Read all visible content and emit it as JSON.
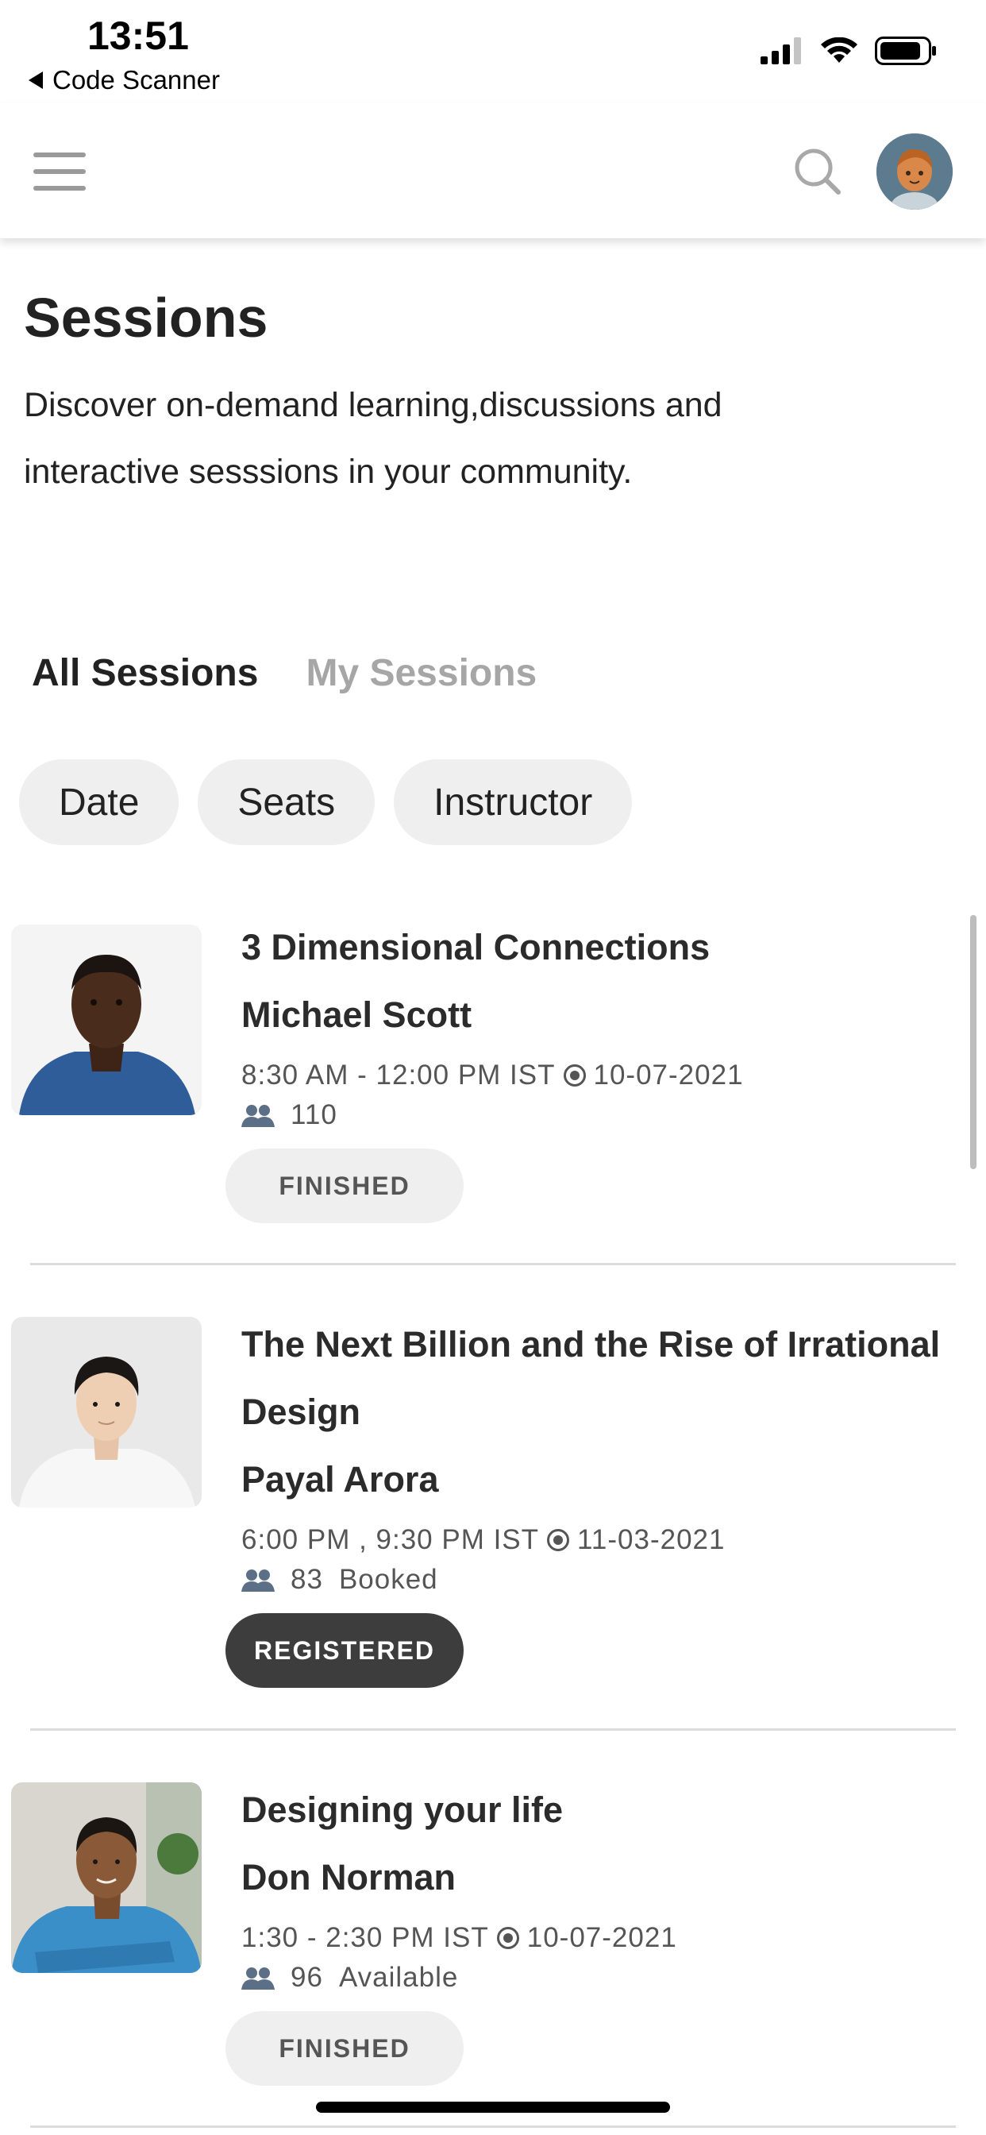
{
  "status_bar": {
    "time": "13:51",
    "back_label": "Code Scanner"
  },
  "header": {
    "menu_icon": "hamburger-icon",
    "search_icon": "search-icon",
    "avatar_icon": "avatar-illustration"
  },
  "page": {
    "title": "Sessions",
    "description": "Discover on-demand learning,discussions and interactive sesssions in your community."
  },
  "tabs": [
    {
      "label": "All Sessions",
      "active": true
    },
    {
      "label": "My Sessions",
      "active": false
    }
  ],
  "filters": [
    {
      "label": "Date"
    },
    {
      "label": "Seats"
    },
    {
      "label": "Instructor"
    }
  ],
  "sessions": [
    {
      "title": "3 Dimensional Connections",
      "instructor": "Michael Scott",
      "time": "8:30 AM - 12:00 PM IST",
      "date": "10-07-2021",
      "seats": "110",
      "seat_status": "",
      "button": "FINISHED"
    },
    {
      "title": "The Next Billion and the Rise of Irrational Design",
      "instructor": "Payal Arora",
      "time": "6:00 PM , 9:30 PM IST",
      "date": "11-03-2021",
      "seats": "83",
      "seat_status": "Booked",
      "button": "REGISTERED"
    },
    {
      "title": "Designing your life",
      "instructor": "Don Norman",
      "time": "1:30 - 2:30 PM IST",
      "date": "10-07-2021",
      "seats": "96",
      "seat_status": "Available",
      "button": "FINISHED"
    }
  ],
  "colors": {
    "accent_dark": "#3d3d3d",
    "chip_bg": "#efefef",
    "muted_text": "#a6a6a6"
  }
}
